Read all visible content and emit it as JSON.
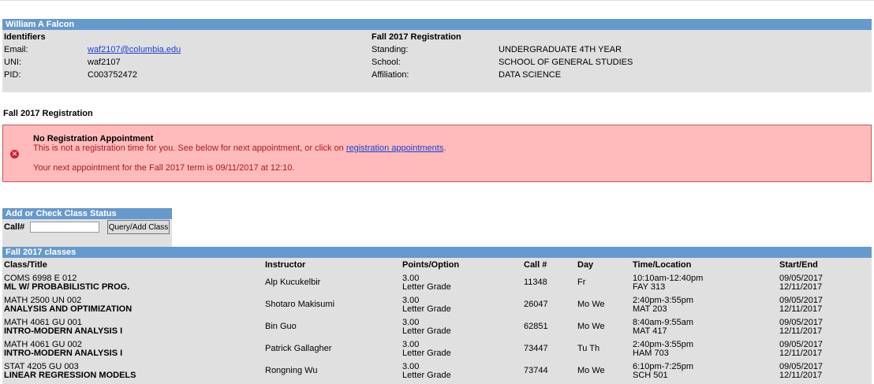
{
  "student": {
    "name": "William A Falcon",
    "identifiers_heading": "Identifiers",
    "email_label": "Email:",
    "email": "waf2107@columbia.edu",
    "uni_label": "UNI:",
    "uni": "waf2107",
    "pid_label": "PID:",
    "pid": "C003752472",
    "registration_heading": "Fall 2017 Registration",
    "standing_label": "Standing:",
    "standing": "UNDERGRADUATE 4TH YEAR",
    "school_label": "School:",
    "school": "SCHOOL OF GENERAL STUDIES",
    "affiliation_label": "Affiliation:",
    "affiliation": "DATA SCIENCE"
  },
  "section_title": "Fall 2017 Registration",
  "alert": {
    "title": "No Registration Appointment",
    "message_prefix": "This is not a registration time for you. See below for next appointment, or click on ",
    "link_text": "registration appointments",
    "message_suffix": ".",
    "next_appointment": "Your next appointment for the Fall 2017 term is 09/11/2017 at 12:10."
  },
  "class_status": {
    "heading": "Add or Check Class Status",
    "call_label": "Call#",
    "call_value": "",
    "button_label": "Query/Add Class"
  },
  "classes": {
    "heading": "Fall 2017 classes",
    "columns": [
      "Class/Title",
      "Instructor",
      "Points/Option",
      "Call #",
      "Day",
      "Time/Location",
      "Start/End"
    ],
    "rows": [
      {
        "code": "COMS 6998 E 012",
        "title": "ML W/ PROBABILISTIC PROG.",
        "instructor": "Alp Kucukelbir",
        "points": "3.00",
        "option": "Letter Grade",
        "call": "11348",
        "day": "Fr",
        "time": "10:10am-12:40pm",
        "location": "FAY 313",
        "start": "09/05/2017",
        "end": "12/11/2017"
      },
      {
        "code": "MATH 2500 UN 002",
        "title": "ANALYSIS AND OPTIMIZATION",
        "instructor": "Shotaro Makisumi",
        "points": "3.00",
        "option": "Letter Grade",
        "call": "26047",
        "day": "Mo We",
        "time": "2:40pm-3:55pm",
        "location": "MAT 203",
        "start": "09/05/2017",
        "end": "12/11/2017"
      },
      {
        "code": "MATH 4061 GU 001",
        "title": "INTRO-MODERN ANALYSIS I",
        "instructor": "Bin Guo",
        "points": "3.00",
        "option": "Letter Grade",
        "call": "62851",
        "day": "Mo We",
        "time": "8:40am-9:55am",
        "location": "MAT 417",
        "start": "09/05/2017",
        "end": "12/11/2017"
      },
      {
        "code": "MATH 4061 GU 002",
        "title": "INTRO-MODERN ANALYSIS I",
        "instructor": "Patrick Gallagher",
        "points": "3.00",
        "option": "Letter Grade",
        "call": "73447",
        "day": "Tu Th",
        "time": "2:40pm-3:55pm",
        "location": "HAM 703",
        "start": "09/05/2017",
        "end": "12/11/2017"
      },
      {
        "code": "STAT 4205 GU 003",
        "title": "LINEAR REGRESSION MODELS",
        "instructor": "Rongning Wu",
        "points": "3.00",
        "option": "Letter Grade",
        "call": "73744",
        "day": "Mo We",
        "time": "6:10pm-7:25pm",
        "location": "SCH 501",
        "start": "09/05/2017",
        "end": "12/11/2017"
      }
    ]
  }
}
